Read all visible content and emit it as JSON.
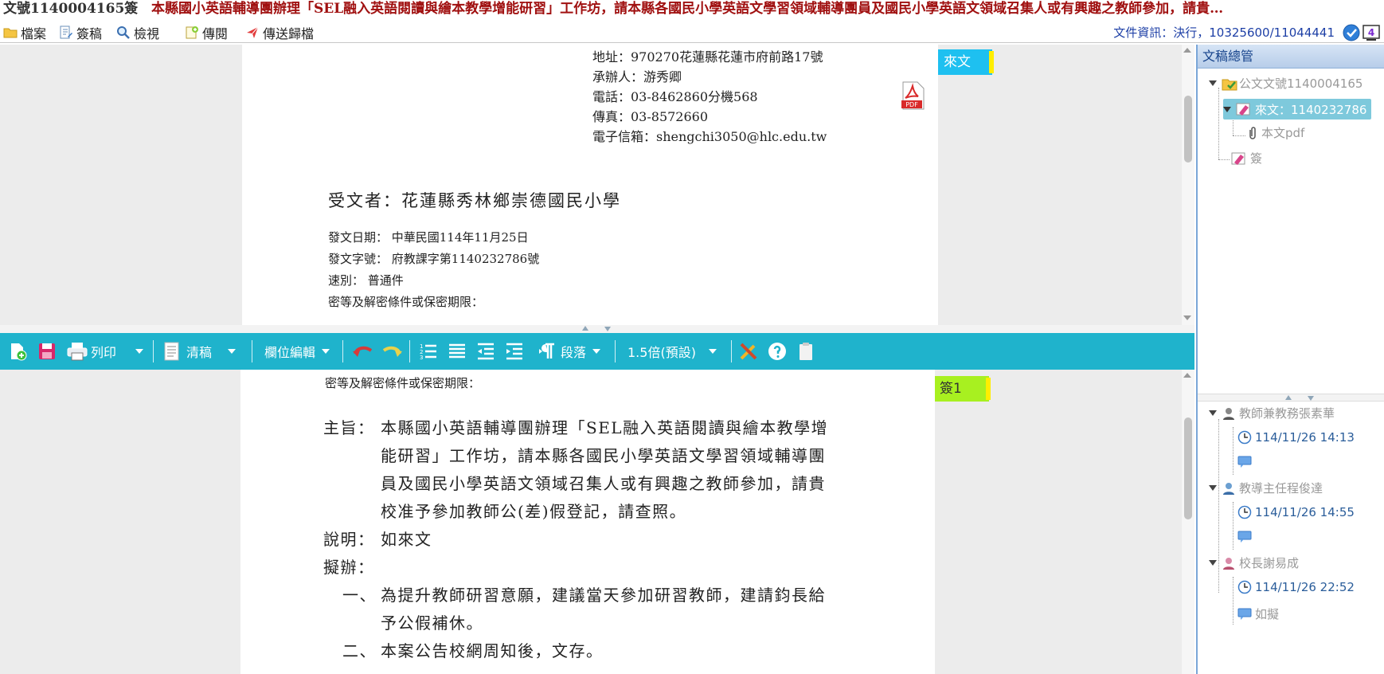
{
  "title_bar": {
    "doc_number": "文號1140004165簽",
    "doc_title": "本縣國小英語輔導團辦理「SEL融入英語閱讀與繪本教學增能研習」工作坊，請本縣各國民小學英語文學習領域輔導團員及國民小學英語文領域召集人或有興趣之教師參加，請貴…"
  },
  "menu": {
    "items": [
      {
        "label": "檔案",
        "icon": "folder-icon"
      },
      {
        "label": "簽稿",
        "icon": "draft-icon"
      },
      {
        "label": "檢視",
        "icon": "search-icon"
      },
      {
        "label": "傳閱",
        "icon": "circulate-icon"
      },
      {
        "label": "傳送歸檔",
        "icon": "send-icon"
      }
    ],
    "file_info": "文件資訊：決行，10325600/11044441",
    "badge_count": "4"
  },
  "top_document": {
    "address_lines": [
      "地址：970270花蓮縣花蓮市府前路17號",
      "承辦人：游秀卿",
      "電話：03-8462860分機568",
      "傳真：03-8572660",
      "電子信箱：shengchi3050@hlc.edu.tw"
    ],
    "pdf_label": "PDF",
    "recipient": "受文者：花蓮縣秀林鄉崇德國民小學",
    "meta_lines": [
      "發文日期： 中華民國114年11月25日",
      "發文字號： 府教課字第1140232786號",
      "速別： 普通件",
      "密等及解密條件或保密期限："
    ],
    "tag": "來文"
  },
  "toolbar": {
    "print": "列印",
    "clean_copy": "清稿",
    "field_edit": "欄位編輯",
    "paragraph": "段落",
    "line_spacing": "1.5倍(預設)"
  },
  "bottom_document": {
    "secret_line": "密等及解密條件或保密期限：",
    "tag": "簽1",
    "subject_label": "主旨：",
    "subject_lines": [
      "本縣國小英語輔導團辦理「SEL融入英語閱讀與繪本教學增",
      "能研習」工作坊，請本縣各國民小學英語文學習領域輔導團",
      "員及國民小學英語文領域召集人或有興趣之教師參加，請貴",
      "校准予參加教師公(差)假登記，請查照。"
    ],
    "desc_label": "說明：",
    "desc_text": "如來文",
    "proposal_label": "擬辦：",
    "proposals": [
      {
        "num": "一、",
        "lines": [
          "為提升教師研習意願，建議當天參加研習教師，建請鈞長給",
          "予公假補休。"
        ]
      },
      {
        "num": "二、",
        "lines": [
          "本案公告校網周知後，文存。"
        ]
      }
    ]
  },
  "right_panel": {
    "header": "文稿總管",
    "tree": {
      "root": "公文文號1140004165",
      "incoming": "來文：1140232786",
      "attachment": "本文pdf",
      "sign": "簽"
    },
    "approvals": [
      {
        "name": "教師兼教務張素華",
        "time": "114/11/26 14:13",
        "comment": ""
      },
      {
        "name": "教導主任程俊達",
        "time": "114/11/26 14:55",
        "comment": ""
      },
      {
        "name": "校長謝易成",
        "time": "114/11/26 22:52",
        "comment": "如擬"
      }
    ]
  },
  "colors": {
    "toolbar": "#1fb3cc",
    "incoming_tag": "#1ec0f0",
    "sign_tag": "#a8f020",
    "title_red": "#a01010",
    "info_blue": "#1d3fa6"
  }
}
